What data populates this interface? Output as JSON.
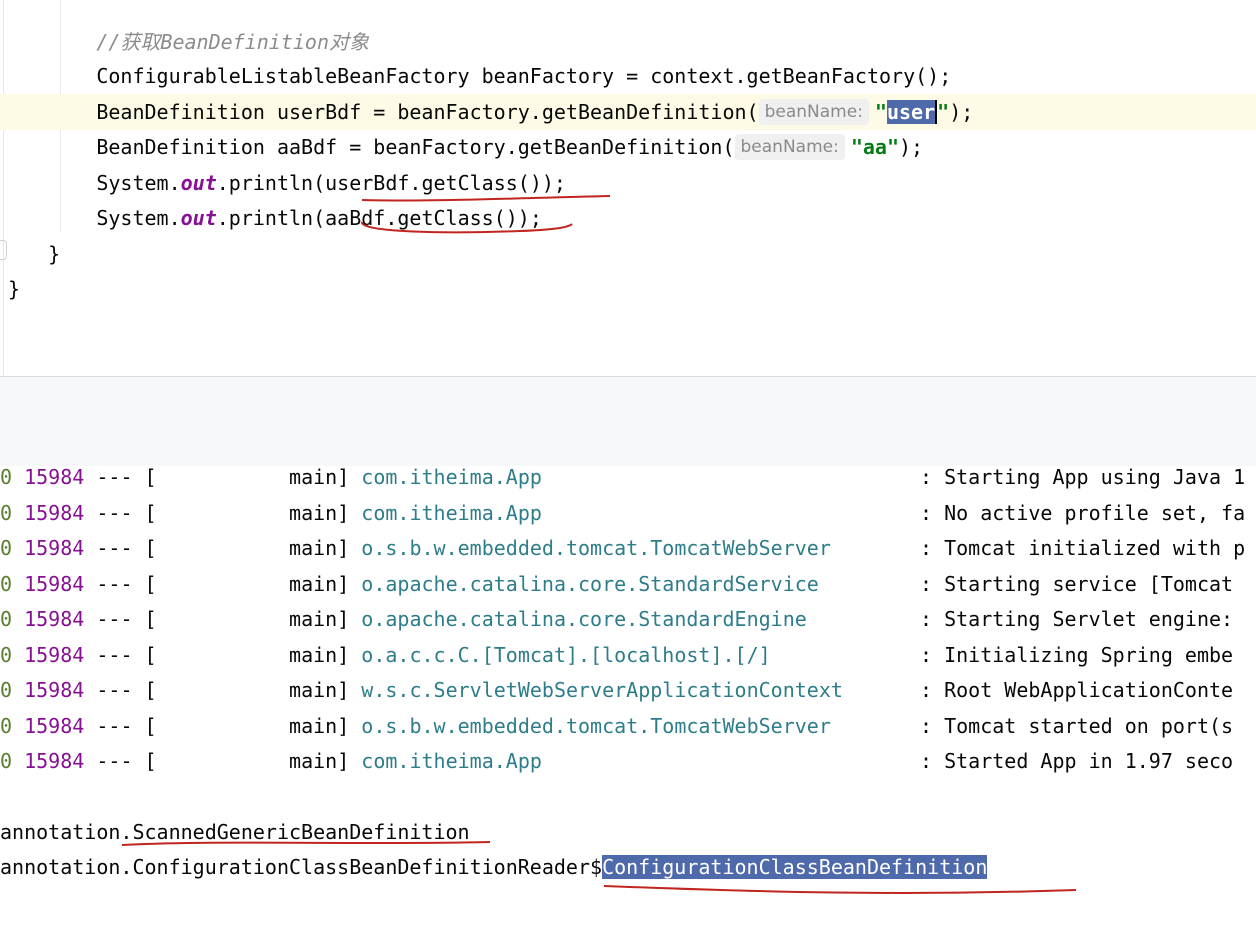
{
  "editor": {
    "lines": [
      {
        "indent": "        ",
        "comment": "//获取BeanDefinition对象"
      },
      {
        "indent": "        ",
        "code": "ConfigurableListableBeanFactory beanFactory = context.getBeanFactory();"
      },
      {
        "indent": "        ",
        "pre": "BeanDefinition userBdf = beanFactory.getBeanDefinition(",
        "hint": "beanName:",
        "str_open": "\"",
        "str_selected": "user",
        "str_close": "\"",
        "post": ");"
      },
      {
        "indent": "        ",
        "pre": "BeanDefinition aaBdf = beanFactory.getBeanDefinition(",
        "hint": "beanName:",
        "str": "\"aa\"",
        "post": ");"
      },
      {
        "indent": "        ",
        "pre": "System.",
        "field": "out",
        "post": ".println(userBdf.getClass());"
      },
      {
        "indent": "        ",
        "pre": "System.",
        "field": "out",
        "post": ".println(aaBdf.getClass());"
      },
      {
        "indent": "    ",
        "code": "}"
      },
      {
        "indent": "",
        "code": "}"
      }
    ]
  },
  "console": {
    "log_rows": [
      {
        "level": "0",
        "pid": "15984",
        "sep": "---",
        "thread": "[           main]",
        "logger": "com.itheima.App",
        "msg": ": Starting App using Java 1"
      },
      {
        "level": "0",
        "pid": "15984",
        "sep": "---",
        "thread": "[           main]",
        "logger": "com.itheima.App",
        "msg": ": No active profile set, fa"
      },
      {
        "level": "0",
        "pid": "15984",
        "sep": "---",
        "thread": "[           main]",
        "logger": "o.s.b.w.embedded.tomcat.TomcatWebServer",
        "msg": ": Tomcat initialized with p"
      },
      {
        "level": "0",
        "pid": "15984",
        "sep": "---",
        "thread": "[           main]",
        "logger": "o.apache.catalina.core.StandardService",
        "msg": ": Starting service [Tomcat"
      },
      {
        "level": "0",
        "pid": "15984",
        "sep": "---",
        "thread": "[           main]",
        "logger": "o.apache.catalina.core.StandardEngine",
        "msg": ": Starting Servlet engine:"
      },
      {
        "level": "0",
        "pid": "15984",
        "sep": "---",
        "thread": "[           main]",
        "logger": "o.a.c.c.C.[Tomcat].[localhost].[/]",
        "msg": ": Initializing Spring embe"
      },
      {
        "level": "0",
        "pid": "15984",
        "sep": "---",
        "thread": "[           main]",
        "logger": "w.s.c.ServletWebServerApplicationContext",
        "msg": ": Root WebApplicationConte"
      },
      {
        "level": "0",
        "pid": "15984",
        "sep": "---",
        "thread": "[           main]",
        "logger": "o.s.b.w.embedded.tomcat.TomcatWebServer",
        "msg": ": Tomcat started on port(s"
      },
      {
        "level": "0",
        "pid": "15984",
        "sep": "---",
        "thread": "[           main]",
        "logger": "com.itheima.App",
        "msg": ": Started App in 1.97 seco"
      }
    ],
    "output_lines": [
      {
        "text": "annotation.ScannedGenericBeanDefinition"
      },
      {
        "text": "annotation.ConfigurationClassBeanDefinitionReader$",
        "selected": "ConfigurationClassBeanDefinition"
      }
    ]
  },
  "colors": {
    "selection": "#4e6aaa",
    "string": "#067d17",
    "field": "#871094",
    "logger": "#2e7d8a",
    "annotation_ink": "#c0261e"
  }
}
